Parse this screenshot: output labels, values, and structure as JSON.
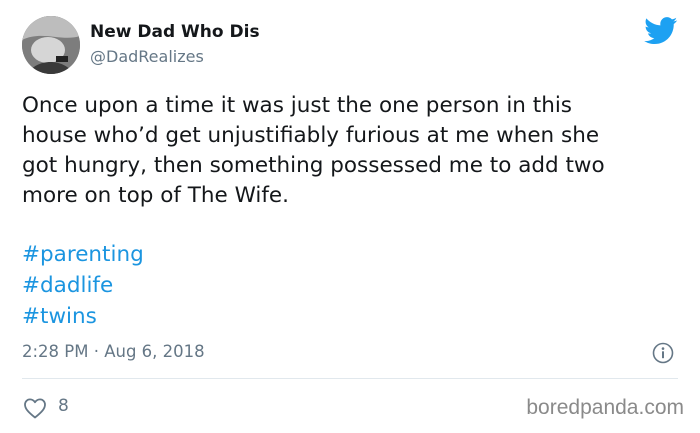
{
  "author": {
    "display_name": "New Dad Who Dis",
    "handle": "@DadRealizes"
  },
  "tweet": {
    "lines": [
      "Once upon a time it was just the one person in this",
      "house who’d get unjustifiably furious at me when she",
      "got hungry, then something possessed me to add two",
      "more on top of The Wife."
    ],
    "hashtags": [
      "#parenting",
      "#dadlife",
      "#twins"
    ],
    "timestamp": "2:28 PM · Aug 6, 2018",
    "likes": "8"
  },
  "icons": {
    "brand": "twitter-bird-icon",
    "info": "info-icon",
    "like": "heart-icon"
  },
  "colors": {
    "twitter_blue": "#1da1f2",
    "hashtag": "#1b95e0",
    "secondary_text": "#657786"
  },
  "watermark": "boredpanda.com"
}
